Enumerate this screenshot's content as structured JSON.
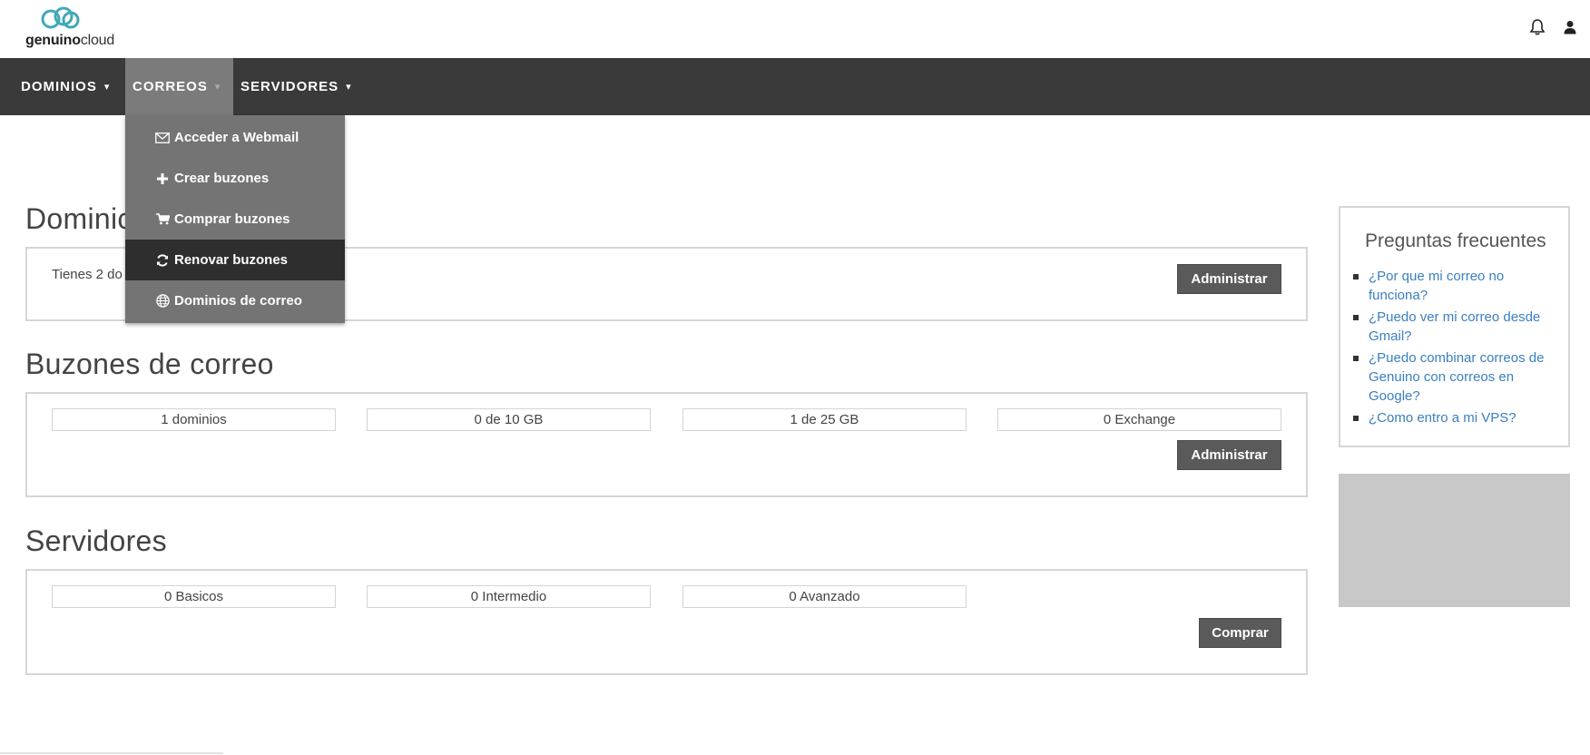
{
  "header": {
    "logo_bold": "genuino",
    "logo_light": "cloud",
    "icons": [
      "bell-icon",
      "user-icon"
    ]
  },
  "nav": {
    "items": [
      {
        "label": "DOMINIOS"
      },
      {
        "label": "CORREOS"
      },
      {
        "label": "SERVIDORES"
      }
    ],
    "caret": "▾"
  },
  "dropdown": {
    "items": [
      {
        "label": "Acceder a Webmail",
        "icon": "envelope-icon"
      },
      {
        "label": "Crear buzones",
        "icon": "plus-icon"
      },
      {
        "label": "Comprar buzones",
        "icon": "cart-icon"
      },
      {
        "label": "Renovar buzones",
        "icon": "refresh-icon"
      },
      {
        "label": "Dominios de correo",
        "icon": "globe-icon"
      }
    ]
  },
  "sections": {
    "dominios": {
      "title": "Dominic",
      "text": "Tienes 2 do",
      "button": "Administrar"
    },
    "buzones": {
      "title": "Buzones de correo",
      "stats": [
        "1 dominios",
        "0 de 10 GB",
        "1 de 25 GB",
        "0 Exchange"
      ],
      "button": "Administrar"
    },
    "servidores": {
      "title": "Servidores",
      "stats": [
        "0 Basicos",
        "0 Intermedio",
        "0 Avanzado"
      ],
      "button": "Comprar"
    }
  },
  "faq": {
    "title": "Preguntas frecuentes",
    "items": [
      "¿Por que mi correo no funciona?",
      "¿Puedo ver mi correo desde Gmail?",
      "¿Puedo combinar correos de Genuino con correos en Google?",
      "¿Como entro a mi VPS?"
    ]
  },
  "colors": {
    "navbar": "#3a3a3a",
    "active_tab": "#7b7b7b",
    "dropdown": "#747474",
    "dropdown_selected": "#2e2e2e",
    "link": "#3a7fc1",
    "logo_accent": "#3fa9b8",
    "button": "#5a5a5a"
  }
}
